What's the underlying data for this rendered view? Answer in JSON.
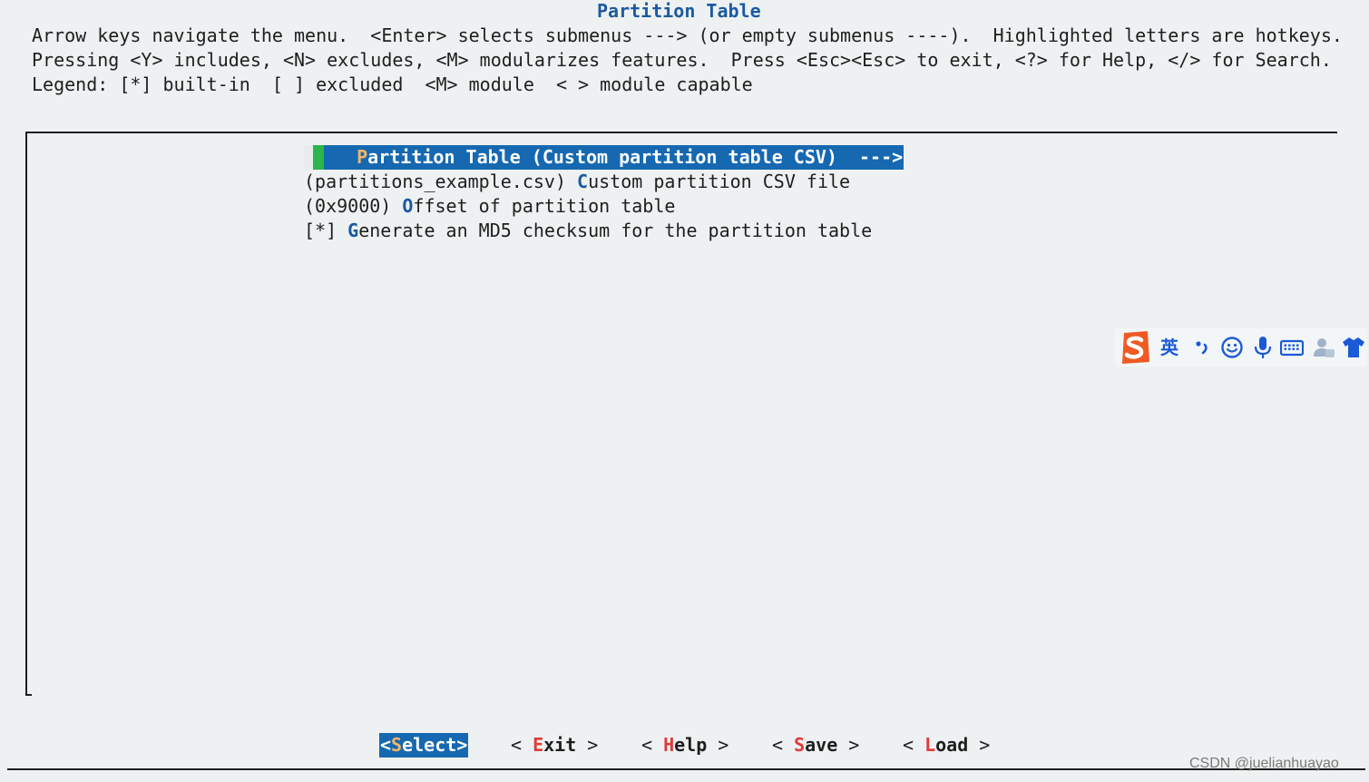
{
  "header": {
    "title": "Partition Table",
    "help_line_1": "Arrow keys navigate the menu.  <Enter> selects submenus ---> (or empty submenus ----).  Highlighted letters are hotkeys.",
    "help_line_2": "Pressing <Y> includes, <N> excludes, <M> modularizes features.  Press <Esc><Esc> to exit, <?> for Help, </> for Search.",
    "help_line_3": "Legend: [*] built-in  [ ] excluded  <M> module  < > module capable"
  },
  "menu": {
    "items": [
      {
        "prefix": "",
        "hotkey": "P",
        "rest": "artition Table (Custom partition table CSV)  --->",
        "selected": true
      },
      {
        "prefix": "(partitions_example.csv) ",
        "hotkey": "C",
        "rest": "ustom partition CSV file",
        "selected": false
      },
      {
        "prefix": "(0x9000) ",
        "hotkey": "O",
        "rest": "ffset of partition table",
        "selected": false
      },
      {
        "prefix": "[*] ",
        "hotkey": "G",
        "rest": "enerate an MD5 checksum for the partition table",
        "selected": false
      }
    ]
  },
  "buttons": {
    "select": {
      "open": "<",
      "hotkey": "S",
      "rest": "elect",
      "close": ">"
    },
    "exit": {
      "open": "< ",
      "hotkey": "E",
      "rest": "xit",
      "close": " >"
    },
    "help": {
      "open": "< ",
      "hotkey": "H",
      "rest": "elp",
      "close": " >"
    },
    "save": {
      "open": "< ",
      "hotkey": "S",
      "rest": "ave",
      "close": " >"
    },
    "load": {
      "open": "< ",
      "hotkey": "L",
      "rest": "oad",
      "close": " >"
    }
  },
  "ime_toolbar": {
    "language": "英",
    "icons": [
      "sogou-logo-icon",
      "punctuation-icon",
      "emoji-icon",
      "microphone-icon",
      "keyboard-icon",
      "user-icon",
      "skin-shirt-icon"
    ]
  },
  "watermark": "CSDN @juelianhuayao",
  "colors": {
    "background": "#eef1f2",
    "selection": "#1668b0",
    "hotkey": "#1b5aa0",
    "button_hotkey": "#e03a3a",
    "cursor_green": "#2bb54b"
  }
}
